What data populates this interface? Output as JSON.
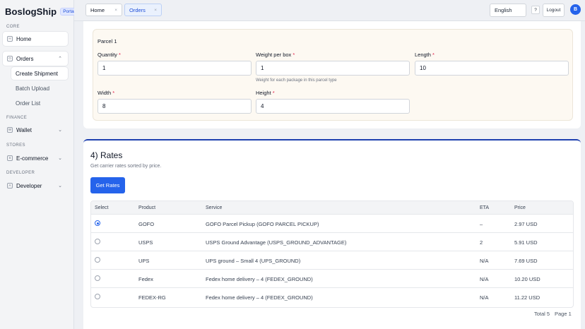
{
  "brand": {
    "name": "BoslogShip",
    "badge": "Portal"
  },
  "sidebar": {
    "sections": {
      "core": "CORE",
      "finance": "FINANCE",
      "stores": "STORES",
      "developer": "DEVELOPER"
    },
    "items": {
      "home": {
        "label": "Home",
        "icon": "H"
      },
      "orders": {
        "label": "Orders",
        "icon": "O"
      },
      "wallet": {
        "label": "Wallet",
        "icon": "W"
      },
      "ecommerce": {
        "label": "E-commerce",
        "icon": "S"
      },
      "developer": {
        "label": "Developer",
        "icon": "A"
      }
    },
    "orders_sub": {
      "create": "Create Shipment",
      "batch": "Batch Upload",
      "list": "Order List"
    }
  },
  "topbar": {
    "tabs": [
      {
        "label": "Home"
      },
      {
        "label": "Orders"
      }
    ],
    "close_glyph": "×",
    "language": "English",
    "help": "?",
    "logout": "Logout",
    "avatar": "B"
  },
  "parcel": {
    "title": "Parcel 1",
    "quantity": {
      "label": "Quantity",
      "value": "1"
    },
    "weight": {
      "label": "Weight per box",
      "value": "1",
      "hint": "Weight for each package in this parcel type"
    },
    "length": {
      "label": "Length",
      "value": "10"
    },
    "width": {
      "label": "Width",
      "value": "8"
    },
    "height": {
      "label": "Height",
      "value": "4"
    },
    "required_mark": "*"
  },
  "rates": {
    "title": "4) Rates",
    "subtitle": "Get carrier rates sorted by price.",
    "button": "Get Rates",
    "columns": {
      "select": "Select",
      "product": "Product",
      "service": "Service",
      "eta": "ETA",
      "price": "Price"
    },
    "rows": [
      {
        "selected": true,
        "product": "GOFO",
        "service": "GOFO Parcel Pickup (GOFO PARCEL PICKUP)",
        "eta": "–",
        "price": "2.97 USD"
      },
      {
        "selected": false,
        "product": "USPS",
        "service": "USPS Ground Advantage (USPS_GROUND_ADVANTAGE)",
        "eta": "2",
        "price": "5.91 USD"
      },
      {
        "selected": false,
        "product": "UPS",
        "service": "UPS ground – Small 4 (UPS_GROUND)",
        "eta": "N/A",
        "price": "7.69 USD"
      },
      {
        "selected": false,
        "product": "Fedex",
        "service": "Fedex home delivery – 4 (FEDEX_GROUND)",
        "eta": "N/A",
        "price": "10.20 USD"
      },
      {
        "selected": false,
        "product": "FEDEX-RG",
        "service": "Fedex home delivery – 4 (FEDEX_GROUND)",
        "eta": "N/A",
        "price": "11.22 USD"
      }
    ],
    "total": "Total 5",
    "page": "Page 1"
  },
  "colors": {
    "primary": "#2563eb",
    "accent_border": "#1e40af",
    "required": "#e11d48"
  }
}
